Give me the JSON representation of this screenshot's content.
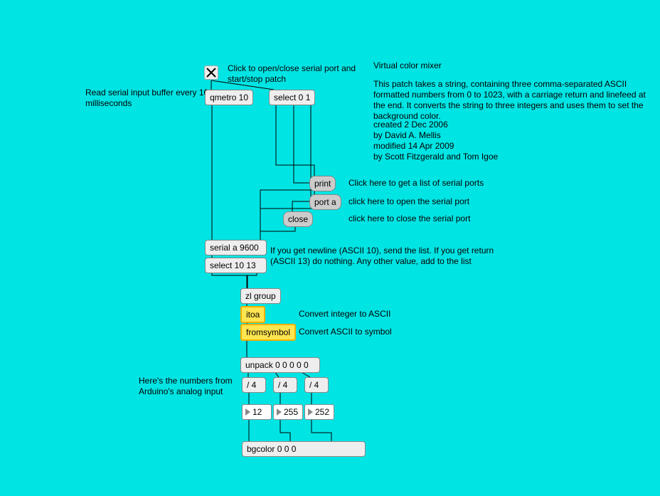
{
  "title": "Virtual color mixer",
  "description": "This patch takes a string, containing three comma-separated ASCII formatted numbers from 0 to 1023, with a carriage return and linefeed at the end.  It converts the string to three integers and uses them to set the background color.",
  "credits": {
    "created": " created 2 Dec 2006",
    "author": " by David A. Mellis",
    "modified": "modified 14 Apr 2009",
    "modified_by": "by Scott Fitzgerald and Tom Igoe"
  },
  "comments": {
    "read_buffer": "Read serial input buffer every 10 milliseconds",
    "toggle_hint": "Click to open/close serial port and start/stop patch",
    "print_hint": "Click here to get a list of serial ports",
    "port_hint": "click here to open the serial port",
    "close_hint": "click here to close the serial port",
    "select_hint": "If you get newline (ASCII 10), send the list. If you get return (ASCII 13) do nothing. Any other value, add to the list",
    "itoa_hint": "Convert integer to ASCII",
    "fromsymbol_hint": "Convert ASCII to symbol",
    "analog_hint": "Here's the numbers from Arduino's analog input"
  },
  "objects": {
    "qmetro": "qmetro 10",
    "select01": "select 0 1",
    "print": "print",
    "port_a": "port a",
    "close": "close",
    "serial": "serial a 9600",
    "select1013": "select 10 13",
    "zlgroup": "zl group",
    "itoa": "itoa",
    "fromsymbol": "fromsymbol",
    "unpack": "unpack 0 0 0 0 0",
    "div1": "/ 4",
    "div2": "/ 4",
    "div3": "/ 4",
    "num1": "12",
    "num2": "255",
    "num3": "252",
    "bgcolor": "bgcolor 0 0 0"
  }
}
